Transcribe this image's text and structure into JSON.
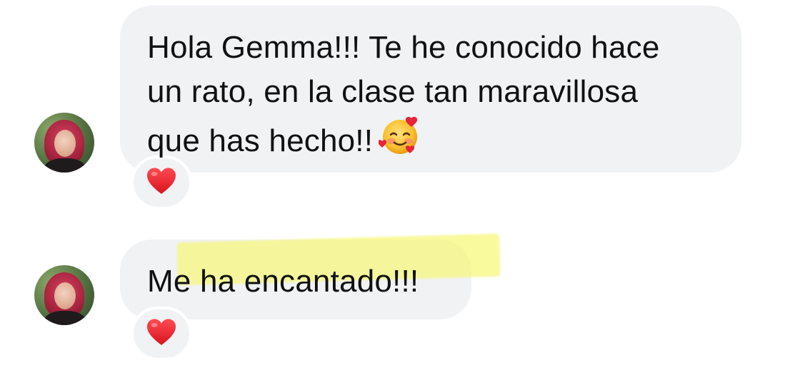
{
  "messages": [
    {
      "lines": [
        "Hola Gemma!!! Te he conocido hace",
        "un rato, en la clase tan maravillosa",
        "que has hecho!!"
      ],
      "emoji": "smiling-face-with-hearts-icon",
      "reaction": "red-heart-icon"
    },
    {
      "lines": [
        "Me ha encantado!!!"
      ],
      "reaction": "red-heart-icon"
    }
  ],
  "colors": {
    "bubble": "#f1f2f4",
    "text": "#111111",
    "highlight": "#f6f678",
    "heart": "#e0242c"
  }
}
